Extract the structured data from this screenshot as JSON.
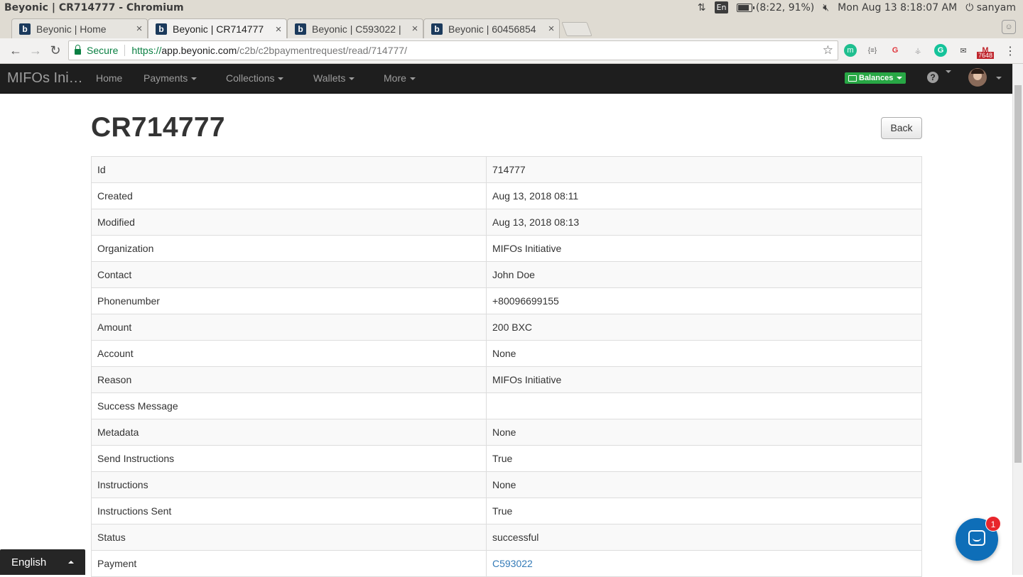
{
  "window": {
    "title": "Beyonic | CR714777 - Chromium"
  },
  "system": {
    "keyboard": "En",
    "battery": "(8:22, 91%)",
    "datetime": "Mon Aug 13  8:18:07 AM",
    "user": "sanyam"
  },
  "tabs": [
    {
      "label": "Beyonic | Home",
      "active": false
    },
    {
      "label": "Beyonic | CR714777",
      "active": true
    },
    {
      "label": "Beyonic | C593022 |",
      "active": false
    },
    {
      "label": "Beyonic | 60456854",
      "active": false
    }
  ],
  "address_bar": {
    "secure_label": "Secure",
    "scheme": "https://",
    "host": "app.beyonic.com",
    "path": "/c2b/c2bpaymentrequest/read/714777/"
  },
  "extensions": {
    "mail_badge": "7648"
  },
  "navbar": {
    "brand": "MIFOs Ini…",
    "home": "Home",
    "payments": "Payments",
    "collections": "Collections",
    "wallets": "Wallets",
    "more": "More",
    "balances": "Balances"
  },
  "page": {
    "title": "CR714777",
    "back_label": "Back",
    "rows": [
      {
        "key": "Id",
        "value": "714777"
      },
      {
        "key": "Created",
        "value": "Aug 13, 2018 08:11"
      },
      {
        "key": "Modified",
        "value": "Aug 13, 2018 08:13"
      },
      {
        "key": "Organization",
        "value": "MIFOs Initiative"
      },
      {
        "key": "Contact",
        "value": "John Doe"
      },
      {
        "key": "Phonenumber",
        "value": "+80096699155"
      },
      {
        "key": "Amount",
        "value": "200 BXC"
      },
      {
        "key": "Account",
        "value": "None"
      },
      {
        "key": "Reason",
        "value": "MIFOs Initiative"
      },
      {
        "key": "Success Message",
        "value": ""
      },
      {
        "key": "Metadata",
        "value": "None"
      },
      {
        "key": "Send Instructions",
        "value": "True"
      },
      {
        "key": "Instructions",
        "value": "None"
      },
      {
        "key": "Instructions Sent",
        "value": "True"
      },
      {
        "key": "Status",
        "value": "successful"
      },
      {
        "key": "Payment",
        "value": "C593022"
      }
    ]
  },
  "language": {
    "label": "English"
  },
  "chat": {
    "unread": "1"
  },
  "colors": {
    "brand_green": "#28a745",
    "navbar": "#1e1e1e",
    "link": "#337ab7",
    "chat": "#0e6eb8"
  }
}
